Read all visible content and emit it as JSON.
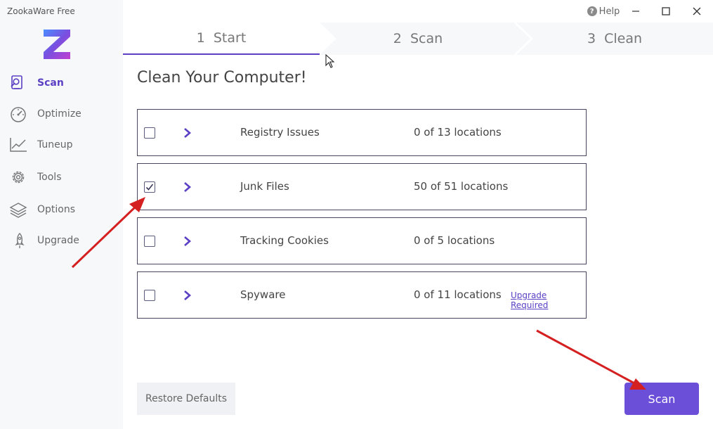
{
  "app": {
    "title": "ZookaWare Free"
  },
  "window": {
    "help_label": "Help",
    "minimize": "—",
    "maximize": "☐",
    "close": "✕"
  },
  "sidebar": {
    "items": [
      {
        "label": "Scan",
        "icon": "scan-icon",
        "active": true
      },
      {
        "label": "Optimize",
        "icon": "speedometer-icon",
        "active": false
      },
      {
        "label": "Tuneup",
        "icon": "chart-line-icon",
        "active": false
      },
      {
        "label": "Tools",
        "icon": "gear-icon",
        "active": false
      },
      {
        "label": "Options",
        "icon": "layers-icon",
        "active": false
      },
      {
        "label": "Upgrade",
        "icon": "rocket-icon",
        "active": false
      }
    ]
  },
  "steps": [
    {
      "number": "1",
      "label": "Start"
    },
    {
      "number": "2",
      "label": "Scan"
    },
    {
      "number": "3",
      "label": "Clean"
    }
  ],
  "main": {
    "title": "Clean Your Computer!",
    "rows": [
      {
        "name": "Registry Issues",
        "count": "0 of 13 locations",
        "checked": false,
        "extra": ""
      },
      {
        "name": "Junk Files",
        "count": "50 of 51 locations",
        "checked": true,
        "extra": ""
      },
      {
        "name": "Tracking Cookies",
        "count": "0 of 5 locations",
        "checked": false,
        "extra": ""
      },
      {
        "name": "Spyware",
        "count": "0 of 11 locations",
        "checked": false,
        "extra": "Upgrade Required"
      }
    ]
  },
  "footer": {
    "restore_label": "Restore Defaults",
    "scan_label": "Scan"
  },
  "colors": {
    "accent": "#5b3fc4",
    "button": "#6b4fd8",
    "annotation": "#d42020"
  }
}
